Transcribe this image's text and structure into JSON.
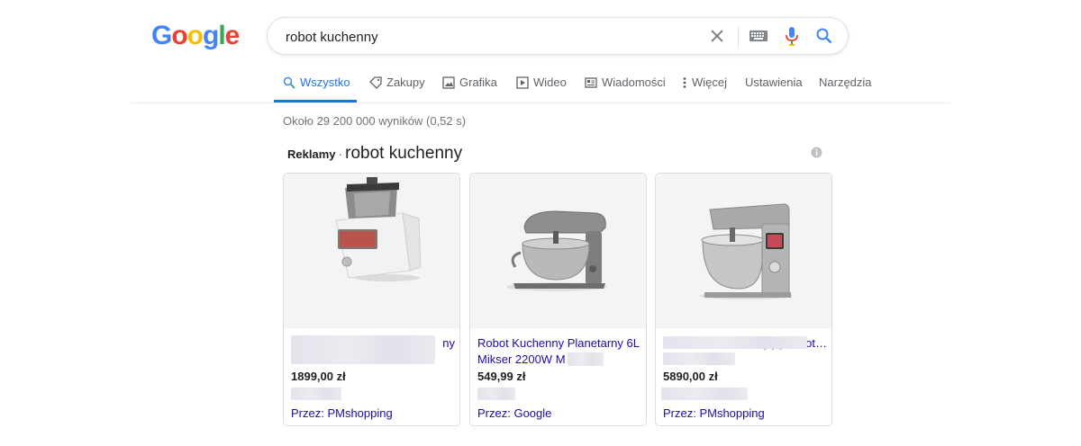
{
  "logo": {
    "letters": [
      "G",
      "o",
      "o",
      "g",
      "l",
      "e"
    ],
    "colors": [
      "#4285F4",
      "#EA4335",
      "#FBBC05",
      "#4285F4",
      "#34A853",
      "#EA4335"
    ]
  },
  "search": {
    "query": "robot kuchenny",
    "icons": [
      "close-icon",
      "keyboard-icon",
      "microphone-icon",
      "search-icon"
    ]
  },
  "tabs": [
    {
      "label": "Wszystko",
      "icon": "search-icon",
      "active": true
    },
    {
      "label": "Zakupy",
      "icon": "tag-icon"
    },
    {
      "label": "Grafika",
      "icon": "image-icon"
    },
    {
      "label": "Wideo",
      "icon": "play-icon"
    },
    {
      "label": "Wiadomości",
      "icon": "news-icon"
    },
    {
      "label": "Więcej",
      "icon": "more-vert-icon"
    },
    {
      "label": "Ustawienia"
    },
    {
      "label": "Narzędzia"
    }
  ],
  "results_count": "Około 29 200 000 wyników (0,52 s)",
  "ads": {
    "label": "Reklamy",
    "separator": "·",
    "query": "robot kuchenny",
    "cards": [
      {
        "title_lines": [
          "ny",
          ""
        ],
        "price": "1899,00 zł",
        "seller": "Przez: PMshopping"
      },
      {
        "title_lines": [
          "Robot Kuchenny Planetarny 6L",
          "Mikser 2200W M"
        ],
        "price": "549,99 zł",
        "seller": "Przez: Google"
      },
      {
        "title_lines": [
          "",
          "Gotujący robot…"
        ],
        "price": "5890,00 zł",
        "seller": "Przez: PMshopping"
      }
    ]
  },
  "colors": {
    "accent": "#1a73e8",
    "link": "#1a0dab",
    "muted": "#70757a"
  }
}
